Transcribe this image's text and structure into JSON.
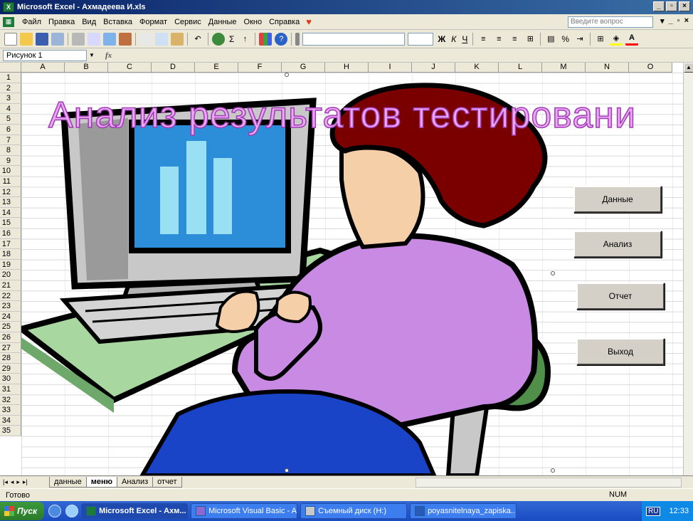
{
  "window": {
    "icon_label": "X",
    "title": "Microsoft Excel - Ахмадеева И.xls",
    "min_label": "_",
    "max_label": "▫",
    "close_label": "×"
  },
  "menu": {
    "items": [
      "Файл",
      "Правка",
      "Вид",
      "Вставка",
      "Формат",
      "Сервис",
      "Данные",
      "Окно",
      "Справка"
    ],
    "question_placeholder": "Введите вопрос",
    "doc_buttons": [
      "▾",
      "_",
      "▫",
      "×"
    ]
  },
  "toolbar": {
    "sum_label": "Σ",
    "bold_label": "Ж",
    "italic_label": "К",
    "underline_label": "Ч",
    "percent_label": "%"
  },
  "formula": {
    "name_box": "Рисунок 1",
    "fx_label": "fx"
  },
  "columns": [
    "A",
    "B",
    "C",
    "D",
    "E",
    "F",
    "G",
    "H",
    "I",
    "J",
    "K",
    "L",
    "M",
    "N",
    "O"
  ],
  "rows": [
    "1",
    "2",
    "3",
    "4",
    "5",
    "6",
    "7",
    "8",
    "9",
    "10",
    "11",
    "12",
    "13",
    "14",
    "15",
    "16",
    "17",
    "18",
    "19",
    "20",
    "21",
    "22",
    "23",
    "24",
    "25",
    "26",
    "27",
    "28",
    "29",
    "30",
    "31",
    "32",
    "33",
    "34",
    "35"
  ],
  "picture": {
    "title": "Анализ результатов тестировани"
  },
  "buttons": {
    "data": "Данные",
    "analysis": "Анализ",
    "report": "Отчет",
    "exit": "Выход"
  },
  "sheets": {
    "nav": [
      "|◂",
      "◂",
      "▸",
      "▸|"
    ],
    "tabs": [
      "данные",
      "меню",
      "Анализ",
      "отчет"
    ],
    "active_index": 1
  },
  "status": {
    "ready": "Готово",
    "num": "NUM"
  },
  "taskbar": {
    "start": "Пуск",
    "tasks": [
      "Microsoft Excel - Ахм...",
      "Microsoft Visual Basic - A...",
      "Съемный диск (H:)",
      "poyasnitelnaya_zapiska...."
    ],
    "lang": "RU",
    "clock": "12:33"
  }
}
